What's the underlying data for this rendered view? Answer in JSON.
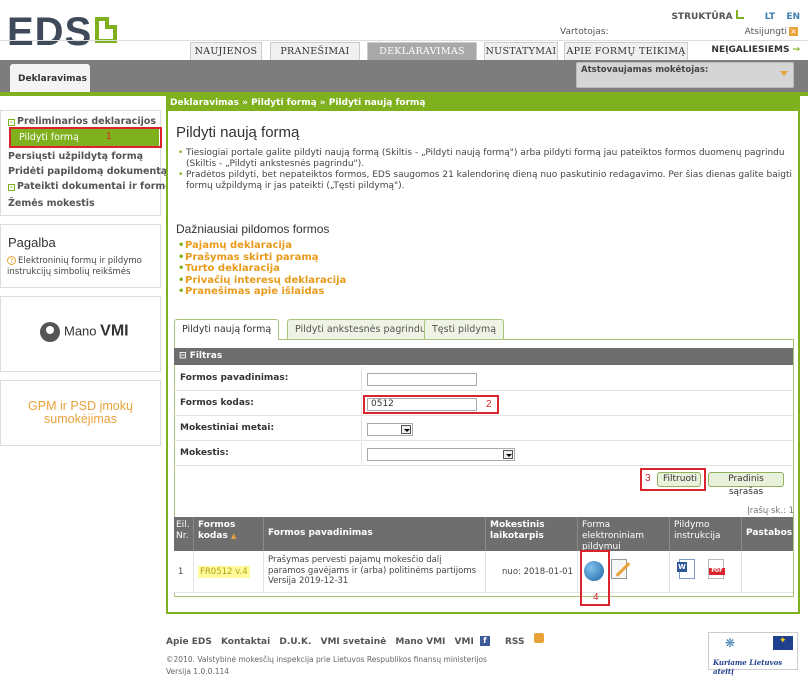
{
  "header": {
    "logo_text": "EDS",
    "struktura": "STRUKTŪRA",
    "lang_lt": "LT",
    "lang_en": "EN",
    "vartotojas": "Vartotojas:",
    "atsijungti": "Atsijungti",
    "neigaliesiems": "NEĮGALIESIEMS",
    "tabs": [
      "NAUJIENOS",
      "PRANEŠIMAI",
      "DEKLARAVIMAS",
      "NUSTATYMAI",
      "APIE FORMŲ TEIKIMĄ"
    ],
    "subtab": "Deklaravimas",
    "atstovaujamas": "Atstovaujamas mokėtojas:"
  },
  "sidebar": {
    "items": [
      "Preliminarios deklaracijos",
      "Pildyti formą",
      "Persiųsti užpildytą formą",
      "Pridėti papildomą dokumentą",
      "Pateikti dokumentai ir formos",
      "Žemės mokestis"
    ],
    "pagalba_title": "Pagalba",
    "pagalba_link": "Elektroninių formų ir pildymo instrukcijų simbolių reikšmės",
    "mano_vmi": "Mano",
    "mano_vmi_bold": "VMI",
    "gpm": "GPM ir PSD įmokų sumokėjimas"
  },
  "annotations": {
    "n1": "1",
    "n2": "2",
    "n3": "3",
    "n4": "4"
  },
  "main": {
    "breadcrumb": "Deklaravimas » Pildyti formą » Pildyti naują formą",
    "title": "Pildyti naują formą",
    "bullet1": "Tiesiogiai portale galite pildyti naują formą (Skiltis - „Pildyti naują formą\") arba pildyti formą jau pateiktos formos duomenų pagrindu (Skiltis - „Pildyti ankstesnės pagrindu\").",
    "bullet2": "Pradėtos pildyti, bet nepateiktos formos, EDS saugomos 21 kalendorinę dieną nuo paskutinio redagavimo. Per šias dienas galite baigti formų užpildymą ir jas pateikti („Tęsti pildymą\").",
    "freq_title": "Dažniausiai pildomos formos",
    "freq_forms": [
      "Pajamų deklaracija",
      "Prašymas skirti paramą",
      "Turto deklaracija",
      "Privačių interesų deklaracija",
      "Pranešimas apie išlaidas"
    ],
    "content_tabs": [
      "Pildyti naują formą",
      "Pildyti ankstesnės pagrindu",
      "Tęsti pildymą"
    ],
    "filter": {
      "header": "Filtras",
      "labels": [
        "Formos pavadinimas:",
        "Formos kodas:",
        "Mokestiniai metai:",
        "Mokestis:"
      ],
      "name_value": "",
      "code_value": "0512",
      "btn_filter": "Filtruoti",
      "btn_reset": "Pradinis sąrašas"
    },
    "count_label": "Įrašų sk.: 1",
    "table": {
      "headers": [
        "Eil. Nr.",
        "Formos kodas",
        "Formos pavadinimas",
        "Mokestinis laikotarpis",
        "Forma elektroniniam pildymui",
        "Pildymo instrukcija",
        "Pastabos"
      ],
      "row": {
        "nr": "1",
        "code": "FR0512 v.4",
        "name": "Prašymas pervesti pajamų mokesčio dalį paramos gavėjams ir (arba) politinėms partijoms",
        "version": "Versija 2019-12-31",
        "period": "nuo: 2018-01-01"
      }
    }
  },
  "footer": {
    "links": [
      "Apie EDS",
      "Kontaktai",
      "D.U.K.",
      "VMI svetainė",
      "Mano VMI",
      "VMI",
      "RSS"
    ],
    "copyright": "©2010. Valstybinė mokesčių inspekcija prie Lietuvos Respublikos finansų ministerijos",
    "version": "Versija 1.0.0.114",
    "eu_text": "Kuriame Lietuvos ateitį"
  },
  "colors": {
    "green": "#7fb11f",
    "orange": "#e8a23a",
    "red": "#d9232d",
    "gray_header": "#6e6e6e"
  }
}
